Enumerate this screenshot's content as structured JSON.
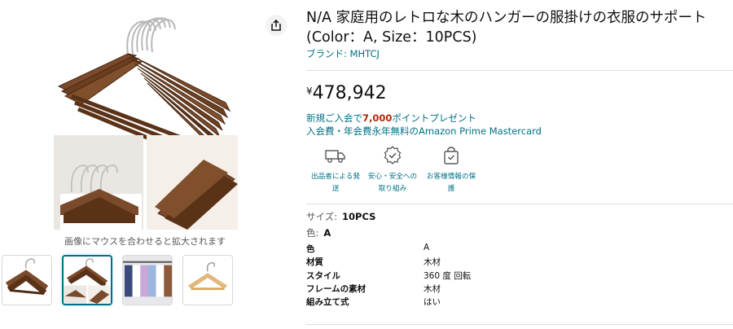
{
  "product": {
    "title": "N/A 家庭用のレトロな木のハンガーの服掛けの衣服のサポート (Color：A, Size：10PCS)",
    "brand": "ブランド: MHTCJ",
    "price_symbol": "¥",
    "price_amount": "478,942"
  },
  "promo": {
    "line1_prefix": "新規ご入会で",
    "line1_points": "7,000",
    "line1_suffix": "ポイントプレゼント",
    "line2": "入会費・年会費永年無料のAmazon Prime Mastercard"
  },
  "features": [
    {
      "icon": "truck-icon",
      "label_line1": "出品者による発",
      "label_line2": "送"
    },
    {
      "icon": "shield-badge-icon",
      "label_line1": "安心・安全への",
      "label_line2": "取り組み"
    },
    {
      "icon": "lock-bag-icon",
      "label_line1": "お客様情報の保",
      "label_line2": "護"
    }
  ],
  "gallery": {
    "zoom_hint": "画像にマウスを合わせると拡大されます",
    "share_icon": "share-icon"
  },
  "variations": {
    "size_label": "サイズ:",
    "size_value": "10PCS",
    "color_label": "色:",
    "color_value": "A"
  },
  "specs": [
    {
      "key": "色",
      "value": "A"
    },
    {
      "key": "材質",
      "value": "木材"
    },
    {
      "key": "スタイル",
      "value": "360 度 回転"
    },
    {
      "key": "フレームの素材",
      "value": "木材"
    },
    {
      "key": "組み立て式",
      "value": "はい"
    }
  ],
  "colors": {
    "link": "#007185",
    "price": "#0f1111",
    "points": "#b12704",
    "thumb_selected_border": "#007185",
    "wood": "#7a4a2a",
    "wood_dark": "#5a3218"
  }
}
